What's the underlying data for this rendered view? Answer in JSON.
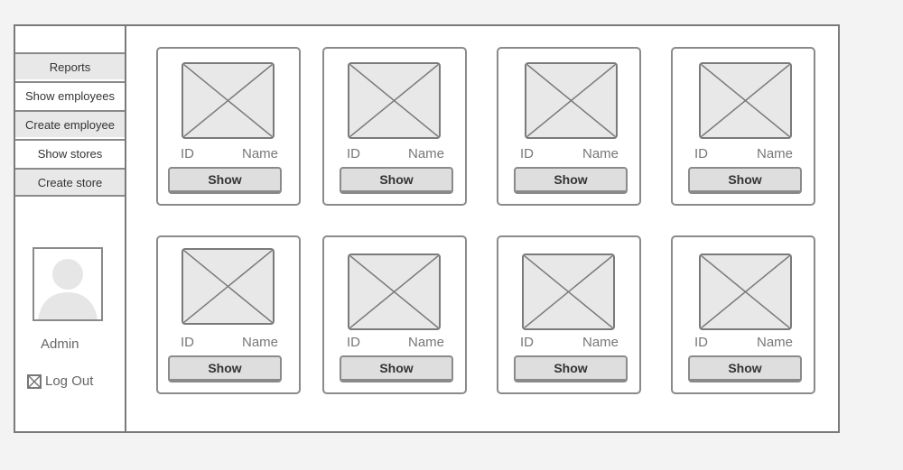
{
  "sidebar": {
    "items": [
      {
        "label": "Reports",
        "style": "shaded"
      },
      {
        "label": "Show employees",
        "style": "plain"
      },
      {
        "label": "Create employee",
        "style": "shaded"
      },
      {
        "label": "Show stores",
        "style": "plain"
      },
      {
        "label": "Create store",
        "style": "shaded"
      }
    ],
    "user_label": "Admin",
    "logout_label": "Log Out",
    "logout_icon": "close-box-icon",
    "avatar_icon": "user-avatar-icon"
  },
  "cards": [
    {
      "id_label": "ID",
      "name_label": "Name",
      "button_label": "Show",
      "image_icon": "image-placeholder-icon"
    },
    {
      "id_label": "ID",
      "name_label": "Name",
      "button_label": "Show",
      "image_icon": "image-placeholder-icon"
    },
    {
      "id_label": "ID",
      "name_label": "Name",
      "button_label": "Show",
      "image_icon": "image-placeholder-icon"
    },
    {
      "id_label": "ID",
      "name_label": "Name",
      "button_label": "Show",
      "image_icon": "image-placeholder-icon"
    },
    {
      "id_label": "ID",
      "name_label": "Name",
      "button_label": "Show",
      "image_icon": "image-placeholder-icon"
    },
    {
      "id_label": "ID",
      "name_label": "Name",
      "button_label": "Show",
      "image_icon": "image-placeholder-icon"
    },
    {
      "id_label": "ID",
      "name_label": "Name",
      "button_label": "Show",
      "image_icon": "image-placeholder-icon"
    },
    {
      "id_label": "ID",
      "name_label": "Name",
      "button_label": "Show",
      "image_icon": "image-placeholder-icon"
    }
  ],
  "colors": {
    "page_background": "#f3f3f3",
    "frame_border": "#7a7a7a",
    "shaded_fill": "#e8e8e8",
    "button_fill": "#dedede"
  }
}
